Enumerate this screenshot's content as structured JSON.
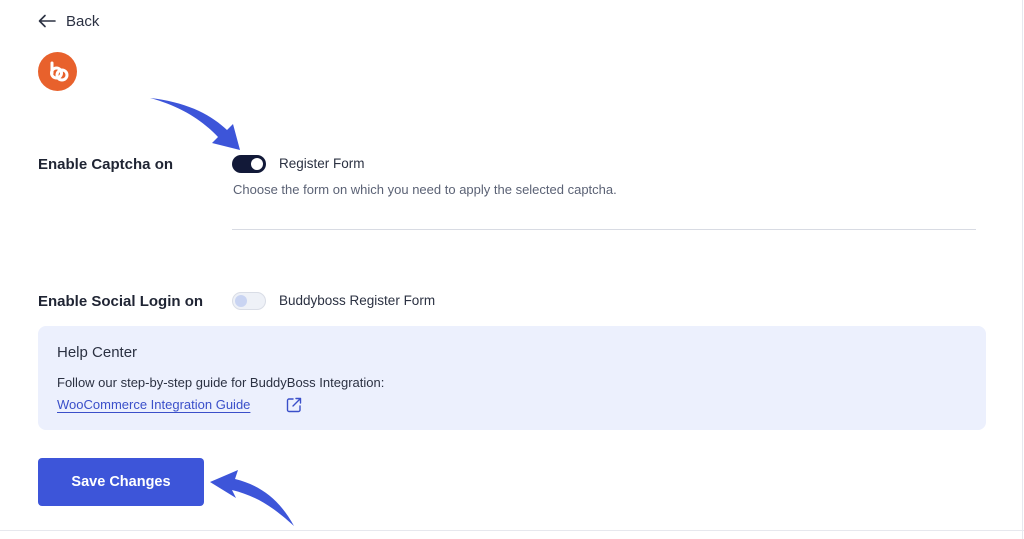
{
  "header": {
    "back_label": "Back",
    "back_icon": "arrow-left-icon",
    "logo_icon": "buddyboss-logo-icon",
    "logo_color": "#e8612c"
  },
  "captcha": {
    "label": "Enable Captcha on",
    "option_label": "Register Form",
    "toggle_on": true,
    "hint": "Choose the form on which you need to apply the selected captcha."
  },
  "social_login": {
    "label": "Enable Social Login on",
    "option_label": "Buddyboss Register Form",
    "toggle_on": false
  },
  "help_center": {
    "title": "Help Center",
    "text": "Follow our step-by-step guide for BuddyBoss Integration:",
    "link_label": "WooCommerce Integration Guide",
    "link_icon": "external-link-icon"
  },
  "actions": {
    "save_label": "Save Changes"
  },
  "colors": {
    "accent": "#3d55d9",
    "toggle_on": "#121938",
    "help_bg": "#ecf0fd",
    "annotation_arrow": "#3d55d9"
  }
}
